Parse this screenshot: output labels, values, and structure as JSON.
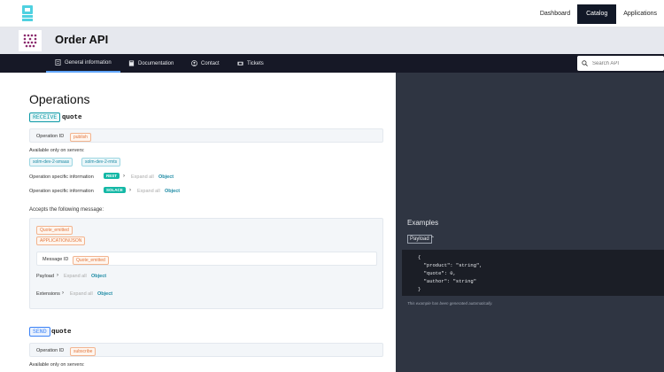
{
  "topnav": {
    "items": [
      "Dashboard",
      "Catalog",
      "Applications"
    ],
    "active": "Catalog"
  },
  "api": {
    "title": "Order API"
  },
  "tabs": [
    {
      "label": "General information",
      "icon": "info-icon"
    },
    {
      "label": "Documentation",
      "icon": "book-icon"
    },
    {
      "label": "Contact",
      "icon": "person-icon"
    },
    {
      "label": "Tickets",
      "icon": "ticket-icon"
    }
  ],
  "search": {
    "placeholder": "Search API"
  },
  "operations": {
    "title": "Operations",
    "op1": {
      "kind": "RECEIVE",
      "name": "quote",
      "id_label": "Operation ID",
      "id_value": "publish",
      "servers_label": "Available only on servers:",
      "servers": [
        "solm-dev-2-smaas",
        "solm-dev-2-rmts"
      ],
      "specific1": {
        "label": "Operation specific information",
        "tag": "REST",
        "expand": "Expand all",
        "object": "Object"
      },
      "specific2": {
        "label": "Operation specific information",
        "tag": "SOLACE",
        "expand": "Expand all",
        "object": "Object"
      },
      "accepts_label": "Accepts the following message:",
      "message": {
        "name": "Quote_emitted",
        "content_type": "APPLICATION/JSON",
        "id_label": "Message ID",
        "id_value": "Quote_emitted",
        "payload_label": "Payload",
        "payload_expand": "Expand all",
        "payload_object": "Object",
        "ext_label": "Extensions",
        "ext_expand": "Expand all",
        "ext_object": "Object"
      }
    },
    "op2": {
      "kind": "SEND",
      "name": "quote",
      "id_label": "Operation ID",
      "id_value": "subscribe",
      "servers_label": "Available only on servers:"
    }
  },
  "examples": {
    "title": "Examples",
    "tab": "Payload",
    "code": [
      "{",
      "  \"product\": \"string\",",
      "  \"quote\": 0,",
      "  \"author\": \"string\"",
      "}"
    ],
    "note": "This example has been generated automatically."
  },
  "colors": {
    "nav_dark": "#161826",
    "panel_dark": "#2f3542",
    "accent_teal": "#14b8a6",
    "tag_orange": "#e2773e"
  }
}
